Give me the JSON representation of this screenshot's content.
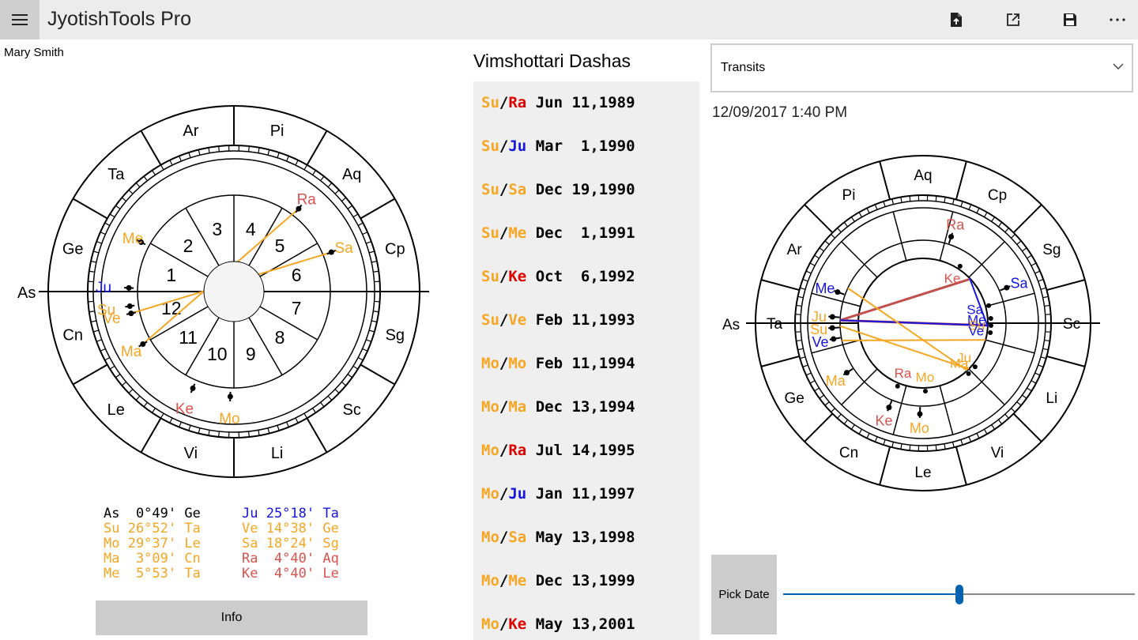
{
  "app": {
    "title": "JyotishTools Pro"
  },
  "toolbar": {
    "icons": [
      "file-export-icon",
      "open-external-icon",
      "save-icon",
      "more-icon"
    ]
  },
  "person": {
    "name": "Mary Smith"
  },
  "colors": {
    "orange": "#f5a623",
    "red": "#d9534f",
    "blue": "#1515e0",
    "dark_red": "#c0504d",
    "dasha_red": "#e00000"
  },
  "natal": {
    "ascendant_label": "As",
    "signs": [
      "Ge",
      "Ta",
      "Ar",
      "Pi",
      "Aq",
      "Cp",
      "Sg",
      "Sc",
      "Li",
      "Vi",
      "Le",
      "Cn"
    ],
    "houses": [
      "1",
      "2",
      "3",
      "4",
      "5",
      "6",
      "7",
      "8",
      "9",
      "10",
      "11",
      "12"
    ],
    "planets": [
      {
        "name": "Ju",
        "color": "#1515e0"
      },
      {
        "name": "Su",
        "color": "#f5a623"
      },
      {
        "name": "Ve",
        "color": "#f5a623"
      },
      {
        "name": "Me",
        "color": "#f5a623"
      },
      {
        "name": "Ma",
        "color": "#f5a623"
      },
      {
        "name": "Ke",
        "color": "#d9534f"
      },
      {
        "name": "Mo",
        "color": "#f5a623"
      },
      {
        "name": "Sa",
        "color": "#f5a623"
      },
      {
        "name": "Ra",
        "color": "#d9534f"
      }
    ]
  },
  "positions": [
    {
      "left": "As  0°49' Ge",
      "right": "Ju 25°18' Ta",
      "lcolor": "#000000",
      "rcolor": "#1515e0"
    },
    {
      "left": "Su 26°52' Ta",
      "right": "Ve 14°38' Ge",
      "lcolor": "#f5a623",
      "rcolor": "#f5a623"
    },
    {
      "left": "Mo 29°37' Le",
      "right": "Sa 18°24' Sg",
      "lcolor": "#f5a623",
      "rcolor": "#f5a623"
    },
    {
      "left": "Ma  3°09' Cn",
      "right": "Ra  4°40' Aq",
      "lcolor": "#f5a623",
      "rcolor": "#d9534f"
    },
    {
      "left": "Me  5°53' Ta",
      "right": "Ke  4°40' Le",
      "lcolor": "#f5a623",
      "rcolor": "#d9534f"
    }
  ],
  "info_button": "Info",
  "dashas": {
    "title": "Vimshottari Dashas",
    "items": [
      {
        "lord1": "Su",
        "lord2": "Ra",
        "date": "Jun 11,1989",
        "c1": "#f5a623",
        "c2": "#e00000"
      },
      {
        "lord1": "Su",
        "lord2": "Ju",
        "date": "Mar  1,1990",
        "c1": "#f5a623",
        "c2": "#1515e0"
      },
      {
        "lord1": "Su",
        "lord2": "Sa",
        "date": "Dec 19,1990",
        "c1": "#f5a623",
        "c2": "#f5a623"
      },
      {
        "lord1": "Su",
        "lord2": "Me",
        "date": "Dec  1,1991",
        "c1": "#f5a623",
        "c2": "#f5a623"
      },
      {
        "lord1": "Su",
        "lord2": "Ke",
        "date": "Oct  6,1992",
        "c1": "#f5a623",
        "c2": "#e00000"
      },
      {
        "lord1": "Su",
        "lord2": "Ve",
        "date": "Feb 11,1993",
        "c1": "#f5a623",
        "c2": "#f5a623"
      },
      {
        "lord1": "Mo",
        "lord2": "Mo",
        "date": "Feb 11,1994",
        "c1": "#f5a623",
        "c2": "#f5a623"
      },
      {
        "lord1": "Mo",
        "lord2": "Ma",
        "date": "Dec 13,1994",
        "c1": "#f5a623",
        "c2": "#f5a623"
      },
      {
        "lord1": "Mo",
        "lord2": "Ra",
        "date": "Jul 14,1995",
        "c1": "#f5a623",
        "c2": "#e00000"
      },
      {
        "lord1": "Mo",
        "lord2": "Ju",
        "date": "Jan 11,1997",
        "c1": "#f5a623",
        "c2": "#1515e0"
      },
      {
        "lord1": "Mo",
        "lord2": "Sa",
        "date": "May 13,1998",
        "c1": "#f5a623",
        "c2": "#f5a623"
      },
      {
        "lord1": "Mo",
        "lord2": "Me",
        "date": "Dec 13,1999",
        "c1": "#f5a623",
        "c2": "#f5a623"
      },
      {
        "lord1": "Mo",
        "lord2": "Ke",
        "date": "May 13,2001",
        "c1": "#f5a623",
        "c2": "#e00000"
      }
    ]
  },
  "transits": {
    "dropdown_value": "Transits",
    "date": "12/09/2017 1:40 PM",
    "ascendant_label": "As",
    "signs": [
      "Ta",
      "Ar",
      "Pi",
      "Aq",
      "Cp",
      "Sg",
      "Sc",
      "Li",
      "Vi",
      "Le",
      "Cn",
      "Ge"
    ],
    "outer_planets": [
      {
        "name": "Me",
        "color": "#1515e0"
      },
      {
        "name": "Ju",
        "color": "#f5a623"
      },
      {
        "name": "Su",
        "color": "#f5a623"
      },
      {
        "name": "Ve",
        "color": "#1515e0"
      },
      {
        "name": "Ma",
        "color": "#f5a623"
      },
      {
        "name": "Ke",
        "color": "#d9534f"
      },
      {
        "name": "Mo",
        "color": "#f5a623"
      },
      {
        "name": "Ra",
        "color": "#d9534f"
      },
      {
        "name": "Sa",
        "color": "#1515e0"
      }
    ],
    "inner_planets": [
      {
        "name": "Ke",
        "color": "#d9534f"
      },
      {
        "name": "Sa",
        "color": "#1515e0"
      },
      {
        "name": "Me",
        "color": "#1515e0"
      },
      {
        "name": "Su",
        "color": "#f5a623"
      },
      {
        "name": "Ve",
        "color": "#1515e0"
      },
      {
        "name": "Ju",
        "color": "#f5a623"
      },
      {
        "name": "Ma",
        "color": "#f5a623"
      },
      {
        "name": "Mo",
        "color": "#f5a623"
      },
      {
        "name": "Ra",
        "color": "#d9534f"
      }
    ]
  },
  "pick_date": {
    "label": "Pick Date",
    "slider_fraction": 0.5
  }
}
